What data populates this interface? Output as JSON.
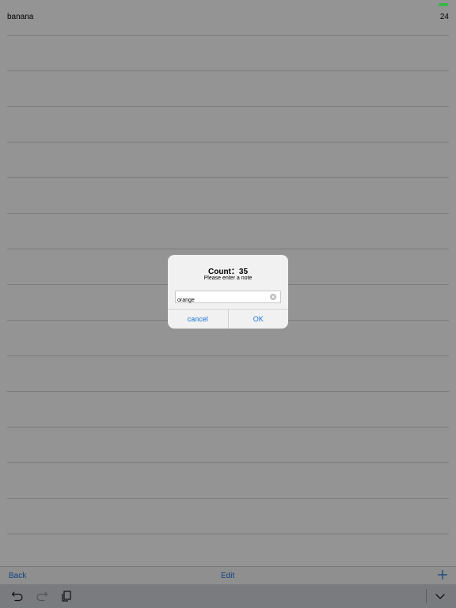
{
  "list": {
    "rows": [
      {
        "label": "banana",
        "value": "24"
      },
      {
        "label": "",
        "value": ""
      },
      {
        "label": "",
        "value": ""
      },
      {
        "label": "",
        "value": ""
      },
      {
        "label": "",
        "value": ""
      },
      {
        "label": "",
        "value": ""
      },
      {
        "label": "",
        "value": ""
      },
      {
        "label": "",
        "value": ""
      },
      {
        "label": "",
        "value": ""
      },
      {
        "label": "",
        "value": ""
      },
      {
        "label": "",
        "value": ""
      },
      {
        "label": "",
        "value": ""
      },
      {
        "label": "",
        "value": ""
      },
      {
        "label": "",
        "value": ""
      },
      {
        "label": "",
        "value": ""
      }
    ]
  },
  "toolbar": {
    "back_label": "Back",
    "edit_label": "Edit",
    "add_icon": "plus-icon"
  },
  "keyboard_toolbar": {
    "undo_icon": "undo-icon",
    "redo_icon": "redo-icon",
    "paste_icon": "paste-icon",
    "dismiss_icon": "chevron-down-icon"
  },
  "dialog": {
    "title": "Count：35",
    "message": "Please enter a note",
    "input_value": "orange",
    "cancel_label": "cancel",
    "ok_label": "OK"
  },
  "colors": {
    "accent": "#1a73d9",
    "status_green": "#3bb54a",
    "overlay": "rgba(0,0,0,0.42)"
  }
}
